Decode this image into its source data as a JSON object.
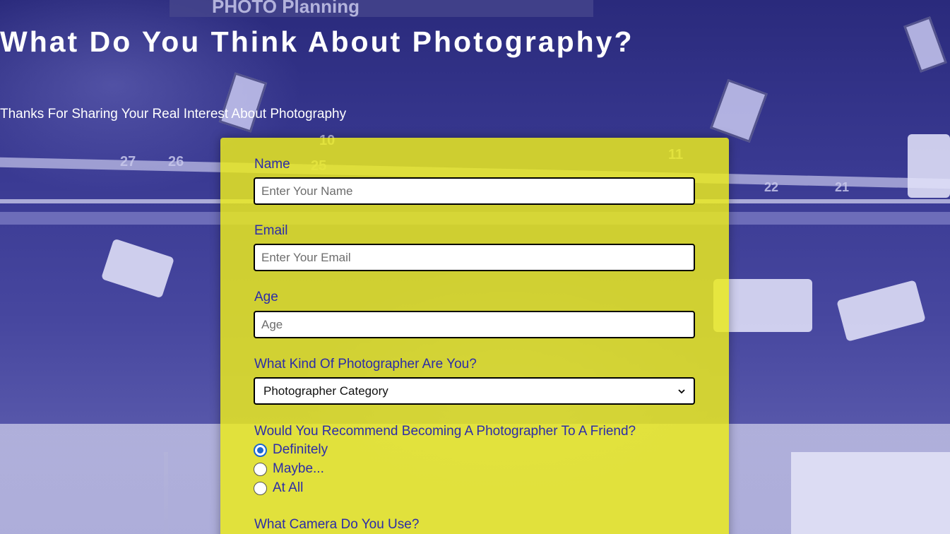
{
  "header": {
    "title": "What Do You Think About Photography?",
    "subtitle": "Thanks For Sharing Your Real Interest About Photography"
  },
  "background": {
    "sign_text": "PHOTO Planning",
    "rail_numbers": [
      "27",
      "26",
      "25",
      "10",
      "11",
      "22",
      "21"
    ]
  },
  "form": {
    "name": {
      "label": "Name",
      "placeholder": "Enter Your Name"
    },
    "email": {
      "label": "Email",
      "placeholder": "Enter Your Email"
    },
    "age": {
      "label": "Age",
      "placeholder": "Age"
    },
    "category": {
      "label": "What Kind Of Photographer Are You?",
      "selected": "Photographer Category"
    },
    "recommend": {
      "label": "Would You Recommend Becoming A Photographer To A Friend?",
      "options": [
        {
          "label": "Definitely",
          "checked": true
        },
        {
          "label": "Maybe...",
          "checked": false
        },
        {
          "label": "At All",
          "checked": false
        }
      ]
    },
    "camera": {
      "label": "What Camera Do You Use?"
    }
  },
  "colors": {
    "form_bg": "#ebeb1e",
    "label_text": "#2c2ca8",
    "title_text": "#ffffff",
    "radio_accent": "#1a66d2"
  }
}
